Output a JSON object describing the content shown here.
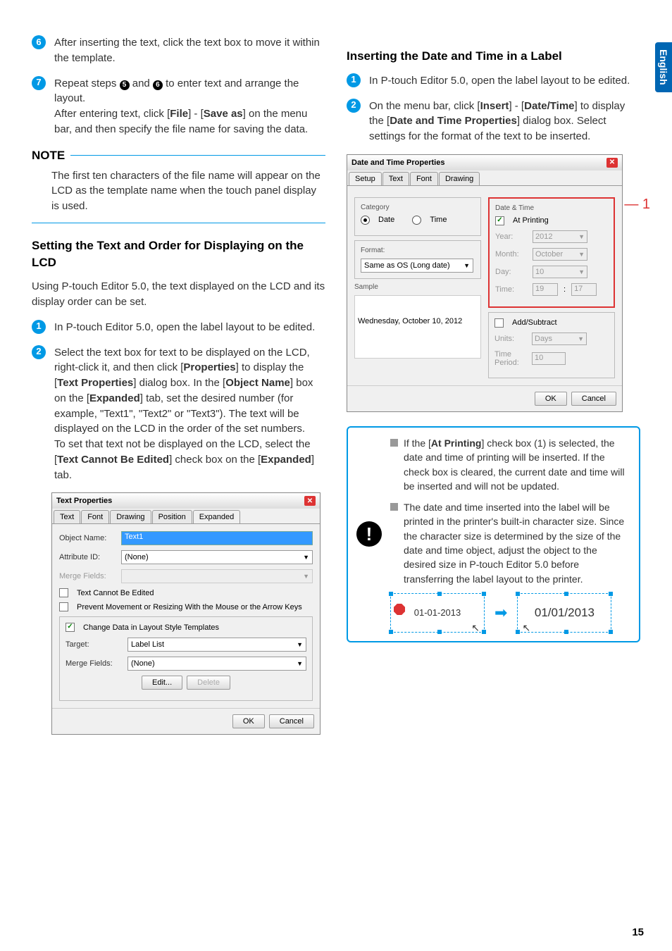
{
  "side_tab": "English",
  "page_number": "15",
  "left": {
    "step6_num": "6",
    "step6_text": "After inserting the text, click the text box to move it within the template.",
    "step7_num": "7",
    "step7_pre": "Repeat steps ",
    "step7_ref1": "5",
    "step7_mid1": " and ",
    "step7_ref2": "6",
    "step7_mid2": " to enter text and arrange the layout.",
    "step7_after": "After entering text, click [",
    "step7_file": "File",
    "step7_sep1": "] - [",
    "step7_saveas": "Save as",
    "step7_tail": "] on the menu bar, and then specify the file name for saving the data.",
    "note_label": "NOTE",
    "note_text": "The first ten characters of the file name will appear on the LCD as the template name when the touch panel display is used.",
    "section1_title": "Setting the Text and Order for Displaying on the LCD",
    "section1_intro": "Using P-touch Editor 5.0, the text displayed on the LCD and its display order can be set.",
    "s1_step1_num": "1",
    "s1_step1_text": "In P-touch Editor 5.0, open the label layout to be edited.",
    "s1_step2_num": "2",
    "s1_step2_p1": "Select the text box for text to be displayed on the LCD, right-click it, and then click [",
    "s1_step2_b1": "Properties",
    "s1_step2_p2": "] to display the [",
    "s1_step2_b2": "Text Properties",
    "s1_step2_p3": "] dialog box. In the [",
    "s1_step2_b3": "Object Name",
    "s1_step2_p4": "] box on the [",
    "s1_step2_b4": "Expanded",
    "s1_step2_p5": "] tab, set the desired number (for example, \"Text1\", \"Text2\" or \"Text3\"). The text will be displayed on the LCD in the order of the set numbers.",
    "s1_step2_p6": "To set that text not be displayed on the LCD, select the [",
    "s1_step2_b5": "Text Cannot Be Edited",
    "s1_step2_p7": "] check box on the [",
    "s1_step2_b6": "Expanded",
    "s1_step2_p8": "] tab.",
    "dlg1": {
      "title": "Text Properties",
      "tabs": [
        "Text",
        "Font",
        "Drawing",
        "Position",
        "Expanded"
      ],
      "obj_name_lbl": "Object Name:",
      "obj_name_val": "Text1",
      "attr_id_lbl": "Attribute ID:",
      "attr_id_val": "(None)",
      "merge_lbl": "Merge Fields:",
      "cb1": "Text Cannot Be Edited",
      "cb2": "Prevent Movement or Resizing With the Mouse or the Arrow Keys",
      "cb3": "Change Data in Layout Style Templates",
      "target_lbl": "Target:",
      "target_val": "Label List",
      "merge2_lbl": "Merge Fields:",
      "merge2_val": "(None)",
      "edit_btn": "Edit...",
      "del_btn": "Delete",
      "ok": "OK",
      "cancel": "Cancel"
    }
  },
  "right": {
    "section2_title": "Inserting the Date and Time in a Label",
    "s2_step1_num": "1",
    "s2_step1_text": "In P-touch Editor 5.0, open the label layout to be edited.",
    "s2_step2_num": "2",
    "s2_step2_p1": "On the menu bar, click [",
    "s2_step2_b1": "Insert",
    "s2_step2_p2": "] - [",
    "s2_step2_b2": "Date/Time",
    "s2_step2_p3": "] to display the [",
    "s2_step2_b3": "Date and Time Properties",
    "s2_step2_p4": "] dialog box. Select settings for the format of the text to be inserted.",
    "callout1": "1",
    "dlg2": {
      "title": "Date and Time Properties",
      "tabs": [
        "Setup",
        "Text",
        "Font",
        "Drawing"
      ],
      "cat_label": "Category",
      "rad_date": "Date",
      "rad_time": "Time",
      "dt_label": "Date & Time",
      "at_printing": "At Printing",
      "year_lbl": "Year:",
      "year_val": "2012",
      "month_lbl": "Month:",
      "month_val": "October",
      "day_lbl": "Day:",
      "day_val": "10",
      "time_lbl": "Time:",
      "time_h": "19",
      "time_m": "17",
      "format_lbl": "Format:",
      "format_val": "Same as OS (Long date)",
      "sample_lbl": "Sample",
      "sample_val": "Wednesday, October 10, 2012",
      "addsub_lbl": "Add/Subtract",
      "units_lbl": "Units:",
      "units_val": "Days",
      "period_lbl": "Time Period:",
      "period_val": "10",
      "ok": "OK",
      "cancel": "Cancel"
    },
    "info": {
      "b1_p1": "If the [",
      "b1_b1": "At Printing",
      "b1_p2": "] check box (1) is selected, the date and time of printing will be inserted. If the check box is cleared, the current date and time will be inserted and will not be updated.",
      "b2": "The date and time inserted into the label will be printed in the printer's built-in character size. Since the character size is determined by the size of the date and time object, adjust the object to the desired size in P-touch Editor 5.0 before transferring the label layout to the printer.",
      "date1": "01-01-2013",
      "date2": "01/01/2013"
    }
  }
}
